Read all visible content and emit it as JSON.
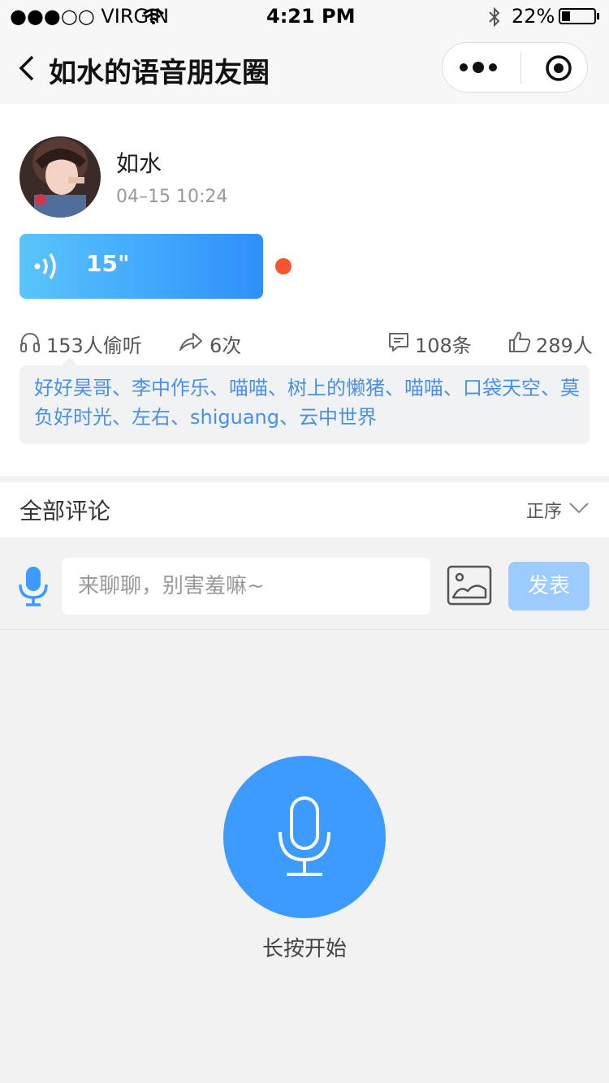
{
  "status_bar": {
    "carrier": "●●●○○ VIRGIN",
    "time": "4:21 PM",
    "battery": "22%"
  },
  "nav": {
    "title": "如水的语音朋友圈"
  },
  "post": {
    "author": "如水",
    "time": "04–15   10:24",
    "voice_duration": "15\"",
    "listen_count": "153人偷听",
    "share_count": "6次",
    "comment_count": "108条",
    "like_count": "289人",
    "listeners": "好好昊哥、李中作乐、喵喵、树上的懒猪、喵喵、口袋天空、莫负好时光、左右、shiguang、云中世界"
  },
  "comments": {
    "title": "全部评论",
    "sort": "正序"
  },
  "composer": {
    "placeholder": "来聊聊，别害羞嘛~",
    "send_label": "发表"
  },
  "record": {
    "label": "长按开始"
  },
  "colors": {
    "accent": "#3d9bff",
    "link": "#4a90e2",
    "unread_dot": "#f4542e"
  }
}
